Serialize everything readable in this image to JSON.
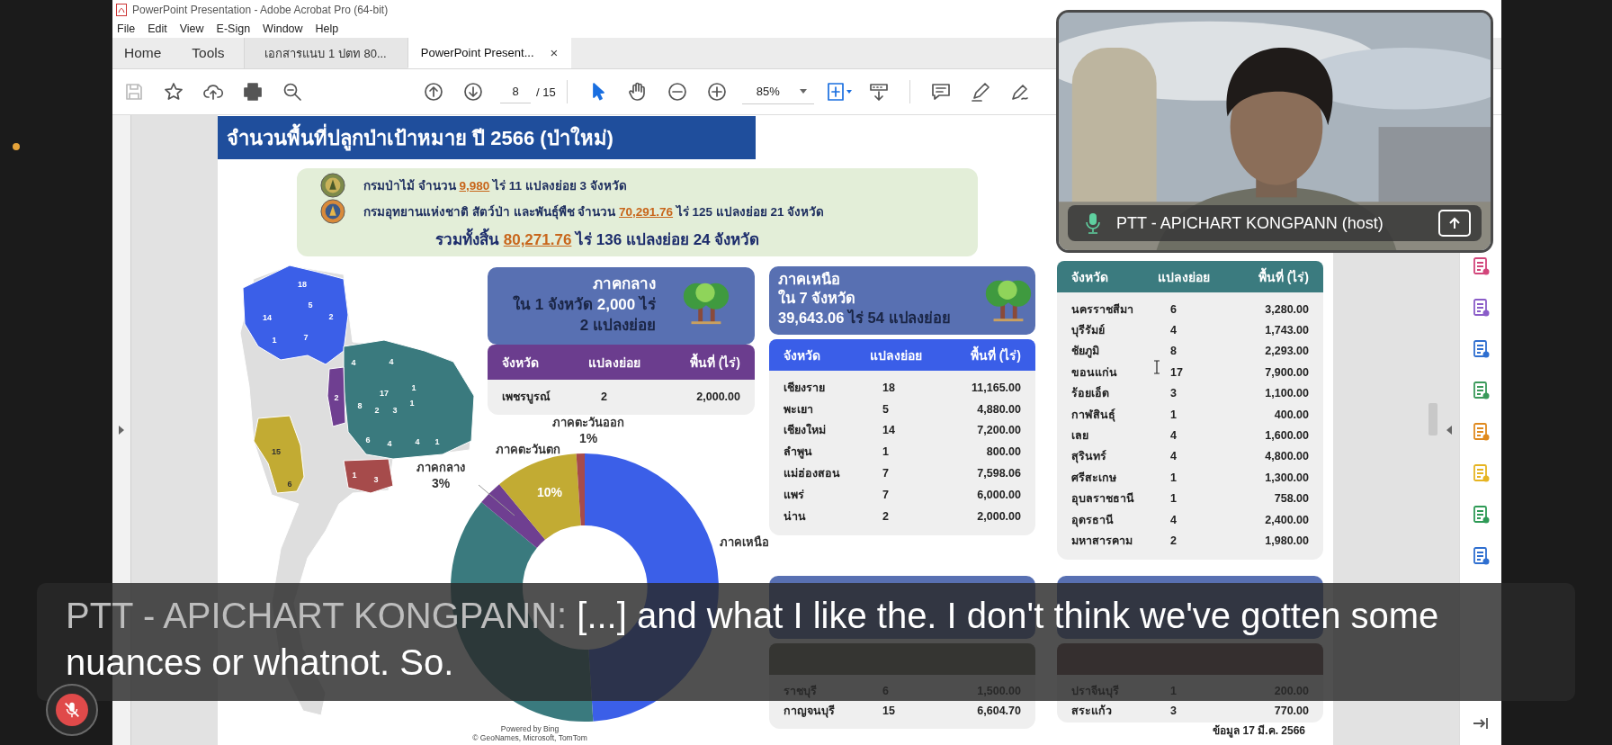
{
  "window": {
    "title": "PowerPoint Presentation - Adobe Acrobat Pro (64-bit)",
    "menu": [
      "File",
      "Edit",
      "View",
      "E-Sign",
      "Window",
      "Help"
    ]
  },
  "tabs": [
    {
      "label": "Home",
      "kind": "nav",
      "selected": false
    },
    {
      "label": "Tools",
      "kind": "nav",
      "selected": false
    },
    {
      "label": "เอกสารแนบ 1 ปตท 80...",
      "kind": "doc",
      "selected": false
    },
    {
      "label": "PowerPoint Present...",
      "kind": "doc",
      "selected": true,
      "close": "×"
    }
  ],
  "toolbar": {
    "page": "8",
    "page_total": "/ 15",
    "zoom": "85%"
  },
  "slide": {
    "title": "จำนวนพื้นที่ปลูกป่าเป้าหมาย ปี 2566 (ป่าใหม่)",
    "summary": {
      "lines": [
        "กรมป่าไม้ จำนวน **9,980** ไร่ 11 แปลงย่อย 3 จังหวัด",
        "กรมอุทยานแห่งชาติ สัตว์ป่า และพันธุ์พืช จำนวน **70,291.76** ไร่ 125 แปลงย่อย 21 จังหวัด"
      ],
      "total": "รวมทั้งสิ้น **80,271.76** ไร่ 136 แปลงย่อย 24 จังหวัด"
    },
    "regions": [
      {
        "kind": "central",
        "color": "#6b3d8e",
        "title": "ภาคกลาง",
        "lines": [
          "ใน 1 จังหวัด **2,000** ไร่",
          "2 แปลงย่อย"
        ],
        "columns": [
          "จังหวัด",
          "แปลงย่อย",
          "พื้นที่ (ไร่)"
        ],
        "rows": [
          [
            "เพชรบูรณ์",
            "2",
            "2,000.00"
          ]
        ]
      },
      {
        "kind": "north",
        "color": "#3a5ee8",
        "title": "ภาคเหนือ",
        "lines": [
          "**ใน 7 จังหวัด**",
          "**39,643.06** ไร่ 54 แปลงย่อย"
        ],
        "columns": [
          "จังหวัด",
          "แปลงย่อย",
          "พื้นที่ (ไร่)"
        ],
        "rows": [
          [
            "เชียงราย",
            "18",
            "11,165.00"
          ],
          [
            "พะเยา",
            "5",
            "4,880.00"
          ],
          [
            "เชียงใหม่",
            "14",
            "7,200.00"
          ],
          [
            "ลำพูน",
            "1",
            "800.00"
          ],
          [
            "แม่ฮ่องสอน",
            "7",
            "7,598.06"
          ],
          [
            "แพร่",
            "7",
            "6,000.00"
          ],
          [
            "น่าน",
            "2",
            "2,000.00"
          ]
        ]
      },
      {
        "kind": "northeast",
        "color": "#3b7b7f",
        "columns": [
          "จังหวัด",
          "แปลงย่อย",
          "พื้นที่ (ไร่)"
        ],
        "rows": [
          [
            "นครราชสีมา",
            "6",
            "3,280.00"
          ],
          [
            "บุรีรัมย์",
            "4",
            "1,743.00"
          ],
          [
            "ชัยภูมิ",
            "8",
            "2,293.00"
          ],
          [
            "ขอนแก่น",
            "17",
            "7,900.00"
          ],
          [
            "ร้อยเอ็ด",
            "3",
            "1,100.00"
          ],
          [
            "กาฬสินธุ์",
            "1",
            "400.00"
          ],
          [
            "เลย",
            "4",
            "1,600.00"
          ],
          [
            "สุรินทร์",
            "4",
            "4,800.00"
          ],
          [
            "ศรีสะเกษ",
            "1",
            "1,300.00"
          ],
          [
            "อุบลราชธานี",
            "1",
            "758.00"
          ],
          [
            "อุดรธานี",
            "4",
            "2,400.00"
          ],
          [
            "มหาสารคาม",
            "2",
            "1,980.00"
          ]
        ]
      },
      {
        "kind": "west",
        "rows": [
          [
            "ราชบุรี",
            "6",
            "1,500.00"
          ],
          [
            "กาญจนบุรี",
            "15",
            "6,604.70"
          ]
        ]
      },
      {
        "kind": "east",
        "rows": [
          [
            "ปราจีนบุรี",
            "1",
            "200.00"
          ],
          [
            "สระแก้ว",
            "3",
            "770.00"
          ]
        ]
      }
    ],
    "map": {
      "labels": [
        {
          "text": "18",
          "kind": "north"
        },
        {
          "text": "5",
          "kind": "north"
        },
        {
          "text": "14",
          "kind": "north"
        },
        {
          "text": "2",
          "kind": "north"
        },
        {
          "text": "1",
          "kind": "north"
        },
        {
          "text": "7",
          "kind": "north"
        },
        {
          "text": "4",
          "kind": "northeast"
        },
        {
          "text": "4",
          "kind": "northeast"
        },
        {
          "text": "8",
          "kind": "northeast"
        },
        {
          "text": "17",
          "kind": "northeast"
        },
        {
          "text": "1",
          "kind": "northeast"
        },
        {
          "text": "1",
          "kind": "northeast"
        },
        {
          "text": "3",
          "kind": "northeast"
        },
        {
          "text": "2",
          "kind": "northeast"
        },
        {
          "text": "6",
          "kind": "northeast"
        },
        {
          "text": "4",
          "kind": "northeast"
        },
        {
          "text": "4",
          "kind": "northeast"
        },
        {
          "text": "1",
          "kind": "northeast"
        },
        {
          "text": "2",
          "kind": "central"
        },
        {
          "text": "15",
          "kind": "west"
        },
        {
          "text": "6",
          "kind": "west"
        },
        {
          "text": "1",
          "kind": "east"
        },
        {
          "text": "3",
          "kind": "east"
        }
      ],
      "credit": [
        "Powered by Bing",
        "© GeoNames, Microsoft, TomTom"
      ]
    },
    "chart_data": {
      "type": "donut",
      "categories": [
        "ภาคเหนือ",
        null,
        "ภาคกลาง",
        "ภาคตะวันตก",
        "ภาคตะวันออก"
      ],
      "values": [
        49,
        37,
        3,
        10,
        1
      ],
      "value_labels": [
        null,
        null,
        "3%",
        "10%",
        "1%"
      ]
    },
    "footnote": "ข้อมูล 17 มี.ค. 2566"
  },
  "video": {
    "name": "PTT - APICHART KONGPANN (host)"
  },
  "caption": {
    "speaker": "PTT - APICHART KONGPANN:",
    "text": "[...] and what I like the. I don't think we've gotten some nuances or whatnot. So."
  },
  "mic": {
    "muted": true
  }
}
